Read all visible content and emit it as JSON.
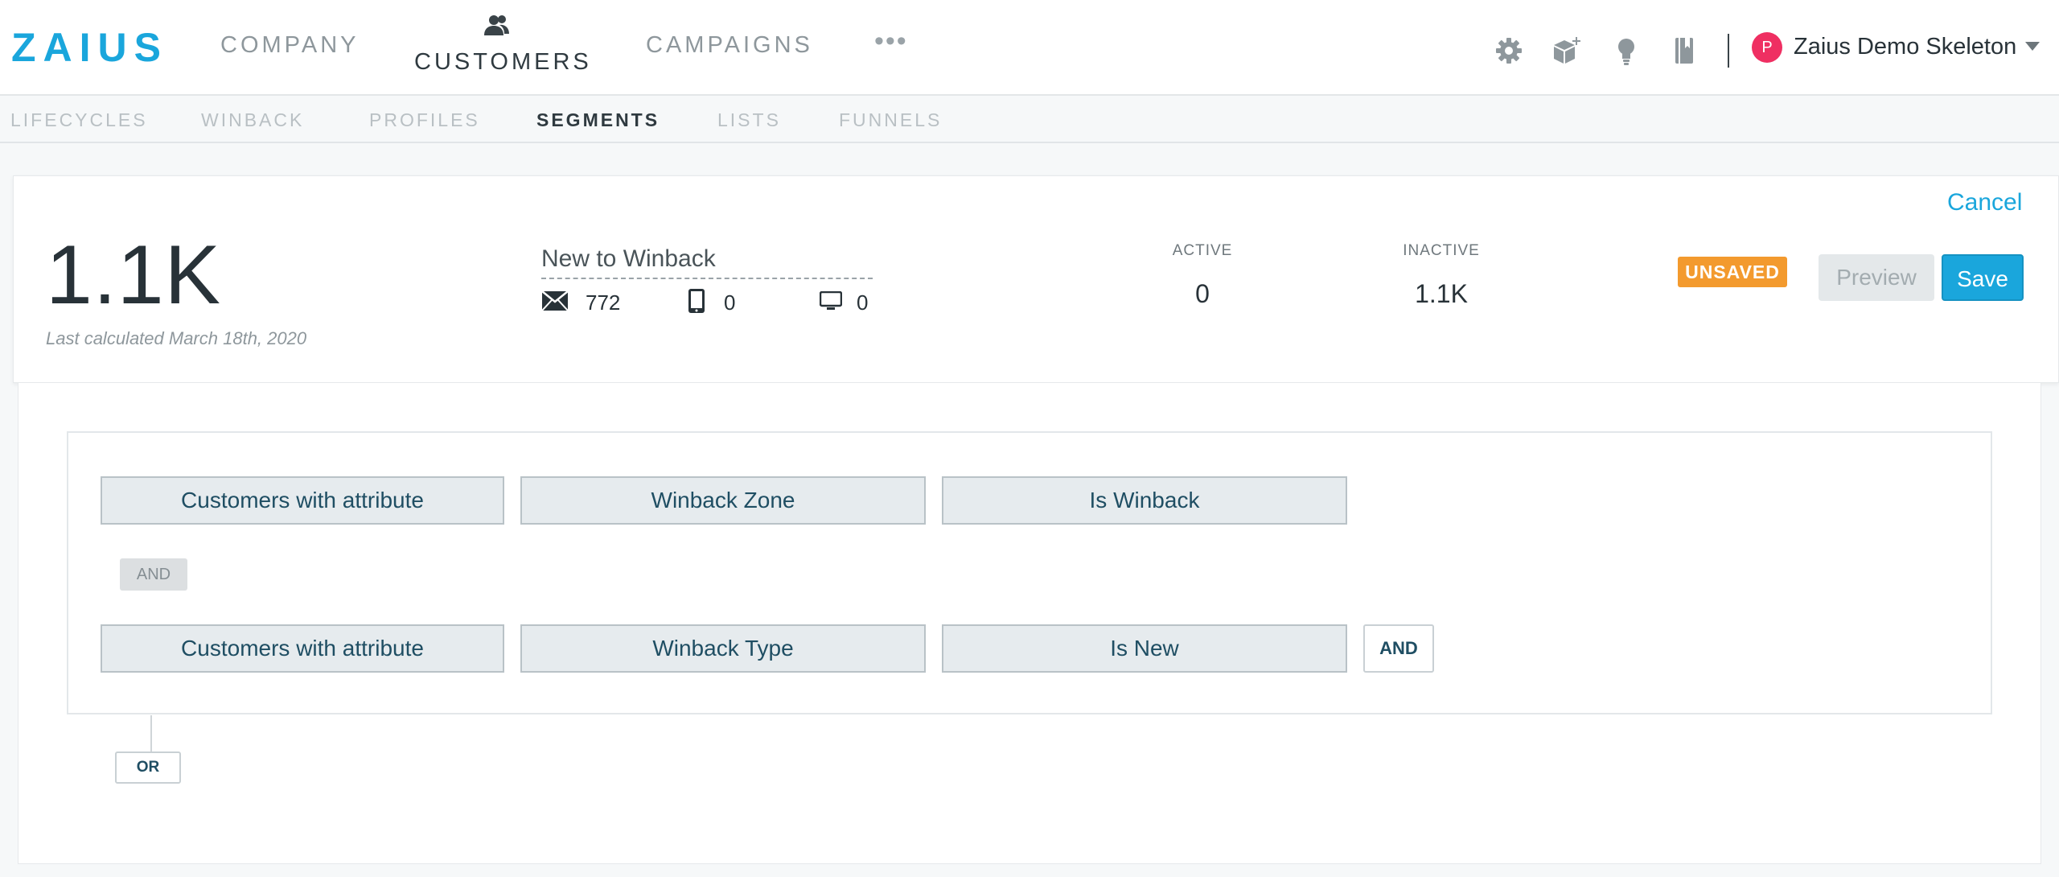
{
  "brand": {
    "logo_text": "ZAIUS",
    "accent_color": "#1aa6dc"
  },
  "top_nav": {
    "items": [
      {
        "label": "COMPANY",
        "active": false
      },
      {
        "label": "CUSTOMERS",
        "active": true,
        "icon": "customers-icon"
      },
      {
        "label": "CAMPAIGNS",
        "active": false
      }
    ],
    "more_label": "•••",
    "icons": [
      "gear-icon",
      "apps-icon",
      "lightbulb-icon",
      "book-icon"
    ],
    "account": {
      "avatar_letter": "P",
      "name": "Zaius Demo Skeleton",
      "avatar_color": "#ef2f62"
    }
  },
  "sub_nav": {
    "items": [
      {
        "label": "LIFECYCLES",
        "active": false
      },
      {
        "label": "WINBACK",
        "active": false
      },
      {
        "label": "PROFILES",
        "active": false
      },
      {
        "label": "SEGMENTS",
        "active": true
      },
      {
        "label": "LISTS",
        "active": false
      },
      {
        "label": "FUNNELS",
        "active": false
      }
    ]
  },
  "summary": {
    "count": "1.1K",
    "last_calculated": "Last calculated March 18th, 2020",
    "segment_name": "New to Winback",
    "reach": {
      "email": "772",
      "mobile": "0",
      "web": "0"
    },
    "active_label": "ACTIVE",
    "active_value": "0",
    "inactive_label": "INACTIVE",
    "inactive_value": "1.1K",
    "cancel_label": "Cancel",
    "status_badge": "UNSAVED",
    "status_color": "#f39a2e",
    "preview_label": "Preview",
    "save_label": "Save"
  },
  "builder": {
    "rows": [
      {
        "subject": "Customers with attribute",
        "attribute": "Winback Zone",
        "condition": "Is Winback"
      },
      {
        "subject": "Customers with attribute",
        "attribute": "Winback Type",
        "condition": "Is New"
      }
    ],
    "and_separator": "AND",
    "and_button": "AND",
    "or_button": "OR"
  }
}
